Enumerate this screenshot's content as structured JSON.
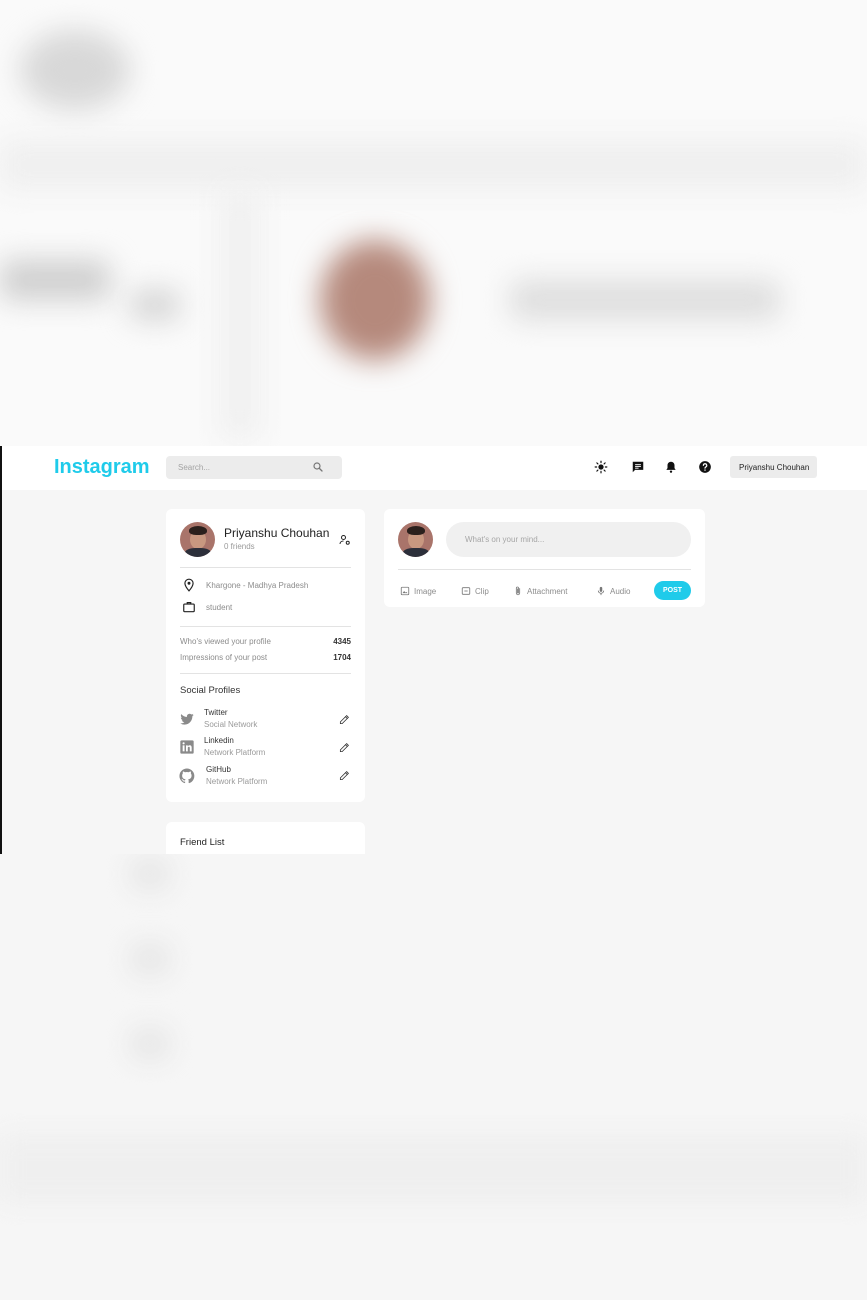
{
  "navbar": {
    "logo": "Instagram",
    "search_placeholder": "Search...",
    "user_name": "Priyanshu Chouhan"
  },
  "profile": {
    "name": "Priyanshu Chouhan",
    "friends": "0 friends",
    "location": "Khargone - Madhya Pradesh",
    "occupation": "student",
    "stats": [
      {
        "label": "Who's viewed your profile",
        "value": "4345"
      },
      {
        "label": "Impressions of your post",
        "value": "1704"
      }
    ],
    "social_title": "Social Profiles",
    "socials": [
      {
        "name": "Twitter",
        "sub": "Social Network",
        "icon": "twitter-icon"
      },
      {
        "name": "Linkedin",
        "sub": "Network Platform",
        "icon": "linkedin-icon"
      },
      {
        "name": "GitHub",
        "sub": "Network Platform",
        "icon": "github-icon"
      }
    ]
  },
  "friend_list": {
    "title": "Friend List"
  },
  "post": {
    "placeholder": "What's on your mind...",
    "actions": [
      "Image",
      "Clip",
      "Attachment",
      "Audio"
    ],
    "button": "POST"
  },
  "colors": {
    "accent": "#1fcbea",
    "background": "#f6f6f6",
    "card": "#ffffff"
  }
}
